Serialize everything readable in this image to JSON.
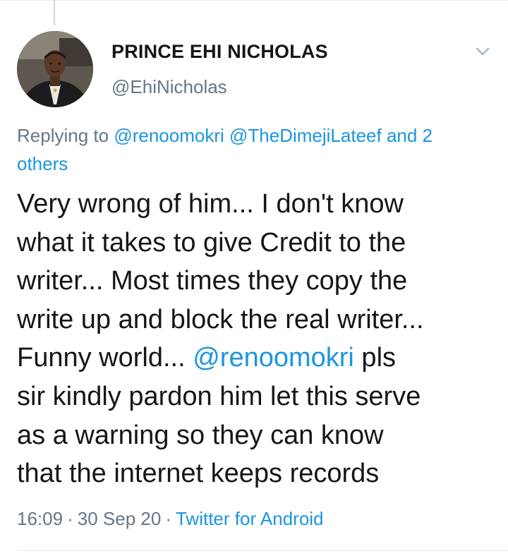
{
  "user": {
    "display_name": "PRINCE EHI NICHOLAS",
    "handle": "@EhiNicholas"
  },
  "reply": {
    "prefix": "Replying to",
    "mention_1": "@renoomokri",
    "mention_2": "@TheDimejiLateef",
    "and_others_line1": "and 2",
    "and_others_line2": "others"
  },
  "tweet": {
    "line_1": "Very wrong of him... I don't know",
    "line_2": "what it takes to give Credit to the",
    "line_3": "writer... Most times they copy the",
    "line_4": "write up and block the real writer...",
    "line_5_prefix": "Funny world... ",
    "line_5_mention": "@renoomokri",
    "line_5_suffix": " pls",
    "line_6": "sir kindly pardon him let this serve",
    "line_7": "as a warning so they can know",
    "line_8": "that the internet keeps records"
  },
  "meta": {
    "time": "16:09",
    "separator": "·",
    "date": "30 Sep 20",
    "source": "Twitter for Android"
  },
  "icons": {
    "caret": "chevron-down-icon",
    "avatar": "profile-photo"
  },
  "colors": {
    "link": "#1b95e0",
    "secondary_text": "#657786",
    "primary_text": "#14171a"
  }
}
